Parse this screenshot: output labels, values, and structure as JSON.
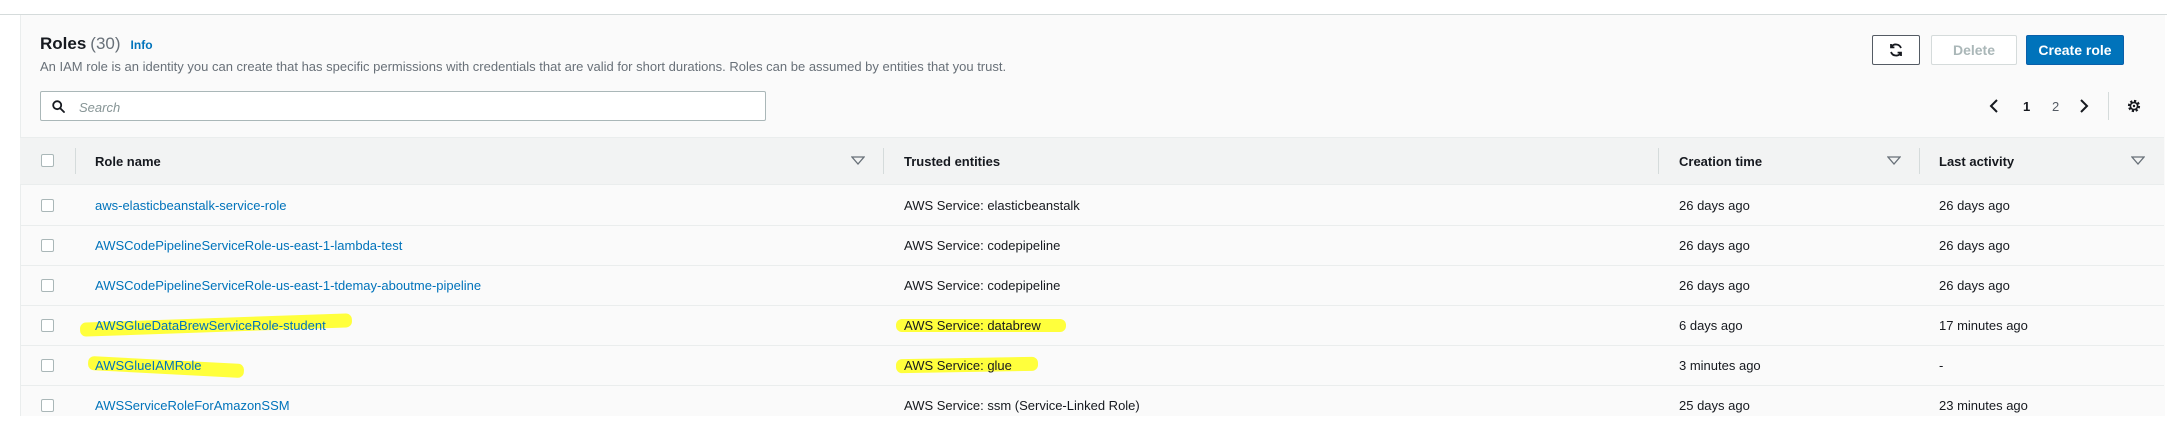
{
  "header": {
    "title": "Roles",
    "count": "(30)",
    "info": "Info",
    "description": "An IAM role is an identity you can create that has specific permissions with credentials that are valid for short durations. Roles can be assumed by entities that you trust."
  },
  "toolbar": {
    "refresh_icon": "refresh-icon",
    "delete_label": "Delete",
    "create_label": "Create role"
  },
  "search": {
    "placeholder": "Search",
    "value": ""
  },
  "pagination": {
    "pages": [
      "1",
      "2"
    ],
    "current_page": "1",
    "prev_icon": "chevron-left-icon",
    "next_icon": "chevron-right-icon",
    "settings_icon": "gear-icon"
  },
  "table": {
    "columns": [
      "Role name",
      "Trusted entities",
      "Creation time",
      "Last activity"
    ],
    "rows": [
      {
        "name": "aws-elasticbeanstalk-service-role",
        "trusted": "AWS Service: elasticbeanstalk",
        "created": "26 days ago",
        "activity": "26 days ago"
      },
      {
        "name": "AWSCodePipelineServiceRole-us-east-1-lambda-test",
        "trusted": "AWS Service: codepipeline",
        "created": "26 days ago",
        "activity": "26 days ago"
      },
      {
        "name": "AWSCodePipelineServiceRole-us-east-1-tdemay-aboutme-pipeline",
        "trusted": "AWS Service: codepipeline",
        "created": "26 days ago",
        "activity": "26 days ago"
      },
      {
        "name": "AWSGlueDataBrewServiceRole-student",
        "trusted": "AWS Service: databrew",
        "created": "6 days ago",
        "activity": "17 minutes ago"
      },
      {
        "name": "AWSGlueIAMRole",
        "trusted": "AWS Service: glue",
        "created": "3 minutes ago",
        "activity": "-"
      },
      {
        "name": "AWSServiceRoleForAmazonSSM",
        "trusted": "AWS Service: ssm (Service-Linked Role)",
        "created": "25 days ago",
        "activity": "23 minutes ago"
      }
    ]
  },
  "colors": {
    "link": "#0073bb",
    "primary_button": "#0073bb",
    "highlight": "#ffff1a"
  }
}
